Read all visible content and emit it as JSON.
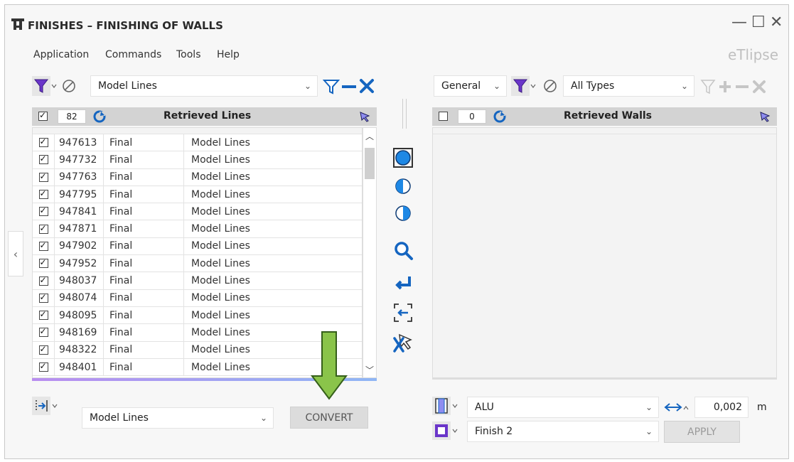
{
  "window": {
    "title": "FINISHES – FINISHING OF WALLS",
    "brand": "eTlipse",
    "controls": {
      "minimize": "—",
      "maximize": "☐",
      "close": "✕"
    }
  },
  "menu": [
    "Application",
    "Commands",
    "Tools",
    "Help"
  ],
  "left": {
    "filter_category": "Model Lines",
    "header": {
      "count": "82",
      "title": "Retrieved Lines",
      "checked": true
    },
    "rows": [
      {
        "id": "947613",
        "phase": "Final",
        "type": "Model Lines"
      },
      {
        "id": "947732",
        "phase": "Final",
        "type": "Model Lines"
      },
      {
        "id": "947763",
        "phase": "Final",
        "type": "Model Lines"
      },
      {
        "id": "947795",
        "phase": "Final",
        "type": "Model Lines"
      },
      {
        "id": "947841",
        "phase": "Final",
        "type": "Model Lines"
      },
      {
        "id": "947871",
        "phase": "Final",
        "type": "Model Lines"
      },
      {
        "id": "947902",
        "phase": "Final",
        "type": "Model Lines"
      },
      {
        "id": "947952",
        "phase": "Final",
        "type": "Model Lines"
      },
      {
        "id": "948037",
        "phase": "Final",
        "type": "Model Lines"
      },
      {
        "id": "948074",
        "phase": "Final",
        "type": "Model Lines"
      },
      {
        "id": "948095",
        "phase": "Final",
        "type": "Model Lines"
      },
      {
        "id": "948169",
        "phase": "Final",
        "type": "Model Lines"
      },
      {
        "id": "948322",
        "phase": "Final",
        "type": "Model Lines"
      },
      {
        "id": "948401",
        "phase": "Final",
        "type": "Model Lines"
      }
    ],
    "convert_category": "Model Lines",
    "convert_label": "CONVERT"
  },
  "right": {
    "group": "General",
    "filter_type": "All Types",
    "header": {
      "count": "0",
      "title": "Retrieved Walls",
      "checked": false
    },
    "material": "ALU",
    "offset": "0,002",
    "unit": "m",
    "finish": "Finish 2",
    "apply_label": "APPLY"
  },
  "colors": {
    "accent": "#1565c0",
    "filter_purple": "#6a35c9",
    "arrow_green": "#8ac44a",
    "highlight": "#8f8df0"
  }
}
